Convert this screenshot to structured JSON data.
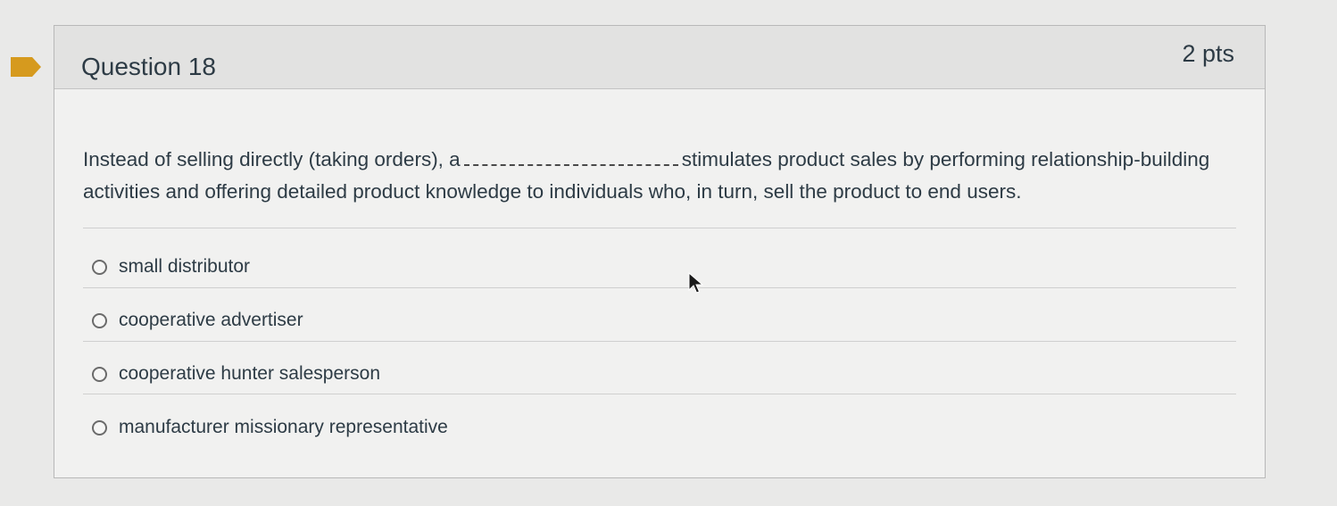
{
  "question": {
    "title": "Question 18",
    "points": "2 pts",
    "text_before_blank": "Instead of selling directly (taking orders), a",
    "text_after_blank": "stimulates product sales by performing relationship-building activities and offering detailed product knowledge to individuals who, in turn, sell the product to end users."
  },
  "answers": [
    {
      "label": "small distributor",
      "selected": false
    },
    {
      "label": "cooperative advertiser",
      "selected": false
    },
    {
      "label": "cooperative hunter salesperson",
      "selected": false
    },
    {
      "label": "manufacturer missionary representative",
      "selected": false
    }
  ],
  "colors": {
    "flag": "#d69a1e",
    "text": "#2d3b45",
    "header_bg": "#e2e2e1",
    "card_bg": "#f1f1f0"
  },
  "icons": {
    "flag": "bookmark-flag-icon",
    "radio": "radio-unchecked-icon",
    "cursor": "mouse-pointer-icon"
  }
}
